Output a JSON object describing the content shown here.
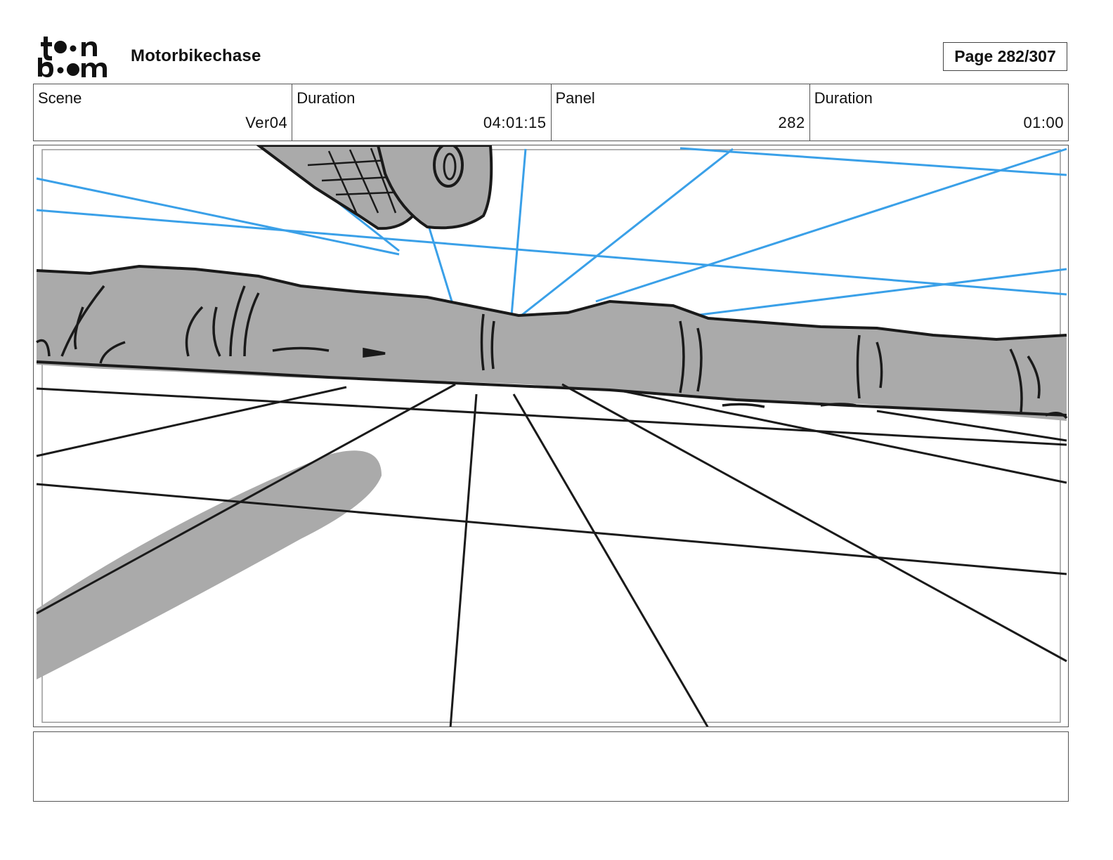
{
  "header": {
    "logo_text_top": "toon",
    "logo_text_bottom": "boom",
    "project_title": "Motorbikechase",
    "page_label": "Page 282/307"
  },
  "info": {
    "scene_label": "Scene",
    "scene_value": "Ver04",
    "scene_duration_label": "Duration",
    "scene_duration_value": "04:01:15",
    "panel_label": "Panel",
    "panel_value": "282",
    "panel_duration_label": "Duration",
    "panel_duration_value": "01:00"
  },
  "notes": {
    "text": ""
  },
  "colors": {
    "sketch_line": "#1a1a1a",
    "perspective_guide": "#3aa0e8",
    "fill_gray": "#aaaaaa"
  }
}
